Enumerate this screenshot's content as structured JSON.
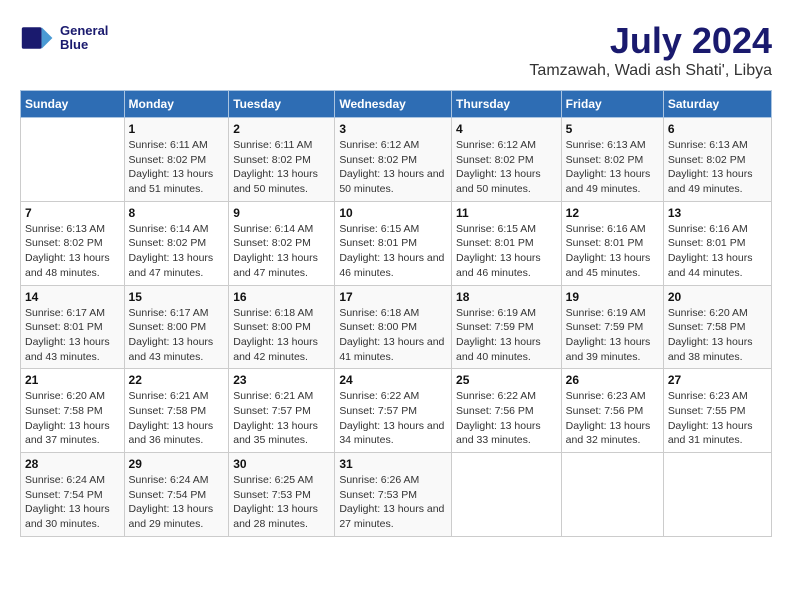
{
  "logo": {
    "line1": "General",
    "line2": "Blue"
  },
  "title": "July 2024",
  "subtitle": "Tamzawah, Wadi ash Shati', Libya",
  "weekdays": [
    "Sunday",
    "Monday",
    "Tuesday",
    "Wednesday",
    "Thursday",
    "Friday",
    "Saturday"
  ],
  "weeks": [
    [
      {
        "day": "",
        "sunrise": "",
        "sunset": "",
        "daylight": ""
      },
      {
        "day": "1",
        "sunrise": "6:11 AM",
        "sunset": "8:02 PM",
        "daylight": "13 hours and 51 minutes."
      },
      {
        "day": "2",
        "sunrise": "6:11 AM",
        "sunset": "8:02 PM",
        "daylight": "13 hours and 50 minutes."
      },
      {
        "day": "3",
        "sunrise": "6:12 AM",
        "sunset": "8:02 PM",
        "daylight": "13 hours and 50 minutes."
      },
      {
        "day": "4",
        "sunrise": "6:12 AM",
        "sunset": "8:02 PM",
        "daylight": "13 hours and 50 minutes."
      },
      {
        "day": "5",
        "sunrise": "6:13 AM",
        "sunset": "8:02 PM",
        "daylight": "13 hours and 49 minutes."
      },
      {
        "day": "6",
        "sunrise": "6:13 AM",
        "sunset": "8:02 PM",
        "daylight": "13 hours and 49 minutes."
      }
    ],
    [
      {
        "day": "7",
        "sunrise": "6:13 AM",
        "sunset": "8:02 PM",
        "daylight": "13 hours and 48 minutes."
      },
      {
        "day": "8",
        "sunrise": "6:14 AM",
        "sunset": "8:02 PM",
        "daylight": "13 hours and 47 minutes."
      },
      {
        "day": "9",
        "sunrise": "6:14 AM",
        "sunset": "8:02 PM",
        "daylight": "13 hours and 47 minutes."
      },
      {
        "day": "10",
        "sunrise": "6:15 AM",
        "sunset": "8:01 PM",
        "daylight": "13 hours and 46 minutes."
      },
      {
        "day": "11",
        "sunrise": "6:15 AM",
        "sunset": "8:01 PM",
        "daylight": "13 hours and 46 minutes."
      },
      {
        "day": "12",
        "sunrise": "6:16 AM",
        "sunset": "8:01 PM",
        "daylight": "13 hours and 45 minutes."
      },
      {
        "day": "13",
        "sunrise": "6:16 AM",
        "sunset": "8:01 PM",
        "daylight": "13 hours and 44 minutes."
      }
    ],
    [
      {
        "day": "14",
        "sunrise": "6:17 AM",
        "sunset": "8:01 PM",
        "daylight": "13 hours and 43 minutes."
      },
      {
        "day": "15",
        "sunrise": "6:17 AM",
        "sunset": "8:00 PM",
        "daylight": "13 hours and 43 minutes."
      },
      {
        "day": "16",
        "sunrise": "6:18 AM",
        "sunset": "8:00 PM",
        "daylight": "13 hours and 42 minutes."
      },
      {
        "day": "17",
        "sunrise": "6:18 AM",
        "sunset": "8:00 PM",
        "daylight": "13 hours and 41 minutes."
      },
      {
        "day": "18",
        "sunrise": "6:19 AM",
        "sunset": "7:59 PM",
        "daylight": "13 hours and 40 minutes."
      },
      {
        "day": "19",
        "sunrise": "6:19 AM",
        "sunset": "7:59 PM",
        "daylight": "13 hours and 39 minutes."
      },
      {
        "day": "20",
        "sunrise": "6:20 AM",
        "sunset": "7:58 PM",
        "daylight": "13 hours and 38 minutes."
      }
    ],
    [
      {
        "day": "21",
        "sunrise": "6:20 AM",
        "sunset": "7:58 PM",
        "daylight": "13 hours and 37 minutes."
      },
      {
        "day": "22",
        "sunrise": "6:21 AM",
        "sunset": "7:58 PM",
        "daylight": "13 hours and 36 minutes."
      },
      {
        "day": "23",
        "sunrise": "6:21 AM",
        "sunset": "7:57 PM",
        "daylight": "13 hours and 35 minutes."
      },
      {
        "day": "24",
        "sunrise": "6:22 AM",
        "sunset": "7:57 PM",
        "daylight": "13 hours and 34 minutes."
      },
      {
        "day": "25",
        "sunrise": "6:22 AM",
        "sunset": "7:56 PM",
        "daylight": "13 hours and 33 minutes."
      },
      {
        "day": "26",
        "sunrise": "6:23 AM",
        "sunset": "7:56 PM",
        "daylight": "13 hours and 32 minutes."
      },
      {
        "day": "27",
        "sunrise": "6:23 AM",
        "sunset": "7:55 PM",
        "daylight": "13 hours and 31 minutes."
      }
    ],
    [
      {
        "day": "28",
        "sunrise": "6:24 AM",
        "sunset": "7:54 PM",
        "daylight": "13 hours and 30 minutes."
      },
      {
        "day": "29",
        "sunrise": "6:24 AM",
        "sunset": "7:54 PM",
        "daylight": "13 hours and 29 minutes."
      },
      {
        "day": "30",
        "sunrise": "6:25 AM",
        "sunset": "7:53 PM",
        "daylight": "13 hours and 28 minutes."
      },
      {
        "day": "31",
        "sunrise": "6:26 AM",
        "sunset": "7:53 PM",
        "daylight": "13 hours and 27 minutes."
      },
      {
        "day": "",
        "sunrise": "",
        "sunset": "",
        "daylight": ""
      },
      {
        "day": "",
        "sunrise": "",
        "sunset": "",
        "daylight": ""
      },
      {
        "day": "",
        "sunrise": "",
        "sunset": "",
        "daylight": ""
      }
    ]
  ]
}
